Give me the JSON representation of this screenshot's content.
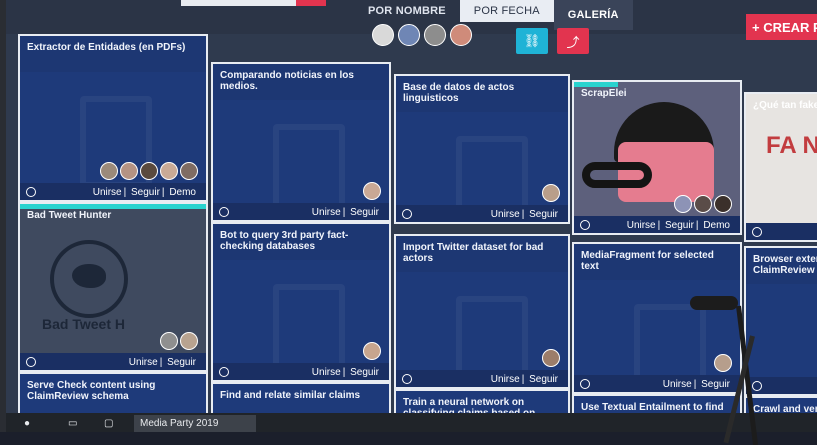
{
  "header": {
    "tabs": [
      "POR NOMBRE",
      "POR FECHA",
      "GALERÍA"
    ],
    "active_tab": "POR FECHA",
    "create_button": "+ CREAR PR",
    "link_icon": "link-icon",
    "share_icon": "share-icon"
  },
  "cards": [
    {
      "title": "Extractor de Entidades (en PDFs)",
      "actions": [
        "Unirse",
        "Seguir",
        "Demo"
      ]
    },
    {
      "title": "Comparando noticias en los medios.",
      "actions": [
        "Unirse",
        "Seguir"
      ]
    },
    {
      "title": "Base de datos de actos linguisticos",
      "actions": [
        "Unirse",
        "Seguir"
      ]
    },
    {
      "title": "ScrapElei",
      "actions": [
        "Unirse",
        "Seguir",
        "Demo"
      ]
    },
    {
      "title": "¿Qué tan fake",
      "actions": []
    },
    {
      "title": "Bad Tweet Hunter",
      "image_text": "Bad Tweet H",
      "actions": [
        "Unirse",
        "Seguir"
      ]
    },
    {
      "title": "Bot to query 3rd party fact-checking databases",
      "actions": [
        "Unirse",
        "Seguir"
      ]
    },
    {
      "title": "Import Twitter dataset for bad actors",
      "actions": [
        "Unirse",
        "Seguir"
      ]
    },
    {
      "title": "MediaFragment for selected text",
      "actions": [
        "Unirse",
        "Seguir"
      ]
    },
    {
      "title": "Browser exten ClaimReview p",
      "actions": []
    },
    {
      "title": "Serve Check content using ClaimReview schema",
      "actions": []
    },
    {
      "title": "Find and relate similar claims",
      "actions": []
    },
    {
      "title": "Train a neural network on classifying claims based on existing credibility indicators",
      "actions": []
    },
    {
      "title": "Use Textual Entailment to find corroborating and contradicting c",
      "actions": []
    },
    {
      "title": "Crawl and ver Schema.org",
      "actions": []
    }
  ],
  "news_image_text": "FA N",
  "taskbar": {
    "items": [
      "Media Party 2019"
    ]
  }
}
